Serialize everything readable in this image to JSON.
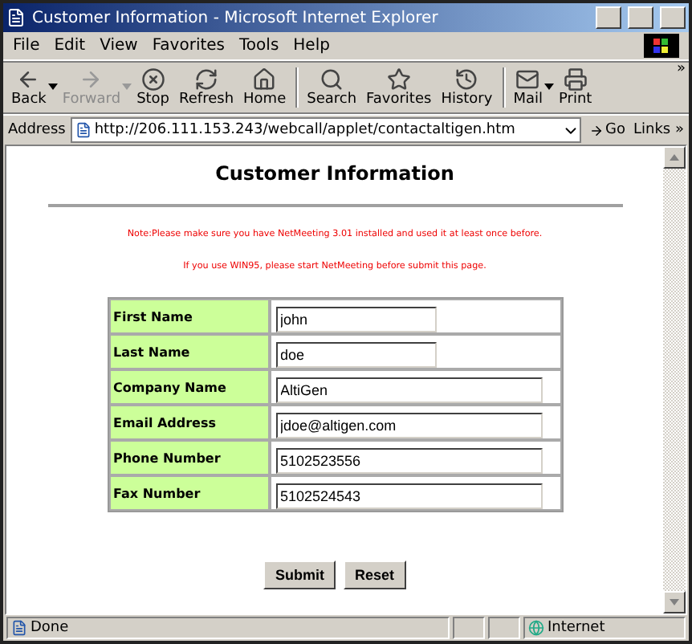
{
  "window": {
    "title": "Customer Information - Microsoft Internet Explorer"
  },
  "menu": [
    "File",
    "Edit",
    "View",
    "Favorites",
    "Tools",
    "Help"
  ],
  "toolbar": {
    "groups": [
      [
        {
          "label": "Back",
          "disabled": false,
          "dropdown": true
        },
        {
          "label": "Forward",
          "disabled": true,
          "dropdown": true
        },
        {
          "label": "Stop",
          "disabled": false,
          "dropdown": false
        },
        {
          "label": "Refresh",
          "disabled": false,
          "dropdown": false
        },
        {
          "label": "Home",
          "disabled": false,
          "dropdown": false
        }
      ],
      [
        {
          "label": "Search",
          "disabled": false,
          "dropdown": false
        },
        {
          "label": "Favorites",
          "disabled": false,
          "dropdown": false
        },
        {
          "label": "History",
          "disabled": false,
          "dropdown": false
        }
      ],
      [
        {
          "label": "Mail",
          "disabled": false,
          "dropdown": true
        },
        {
          "label": "Print",
          "disabled": false,
          "dropdown": false
        }
      ]
    ],
    "more": "»"
  },
  "address_bar": {
    "label": "Address",
    "url": "http://206.111.153.243/webcall/applet/contactaltigen.htm",
    "go": "Go",
    "links": "Links »"
  },
  "page": {
    "heading": "Customer Information",
    "notes": [
      "Note:Please make sure you have NetMeeting 3.01 installed and used it at least once before.",
      "If you use WIN95, please start NetMeeting before submit this page."
    ],
    "form": [
      {
        "label": "First Name",
        "value": "john",
        "kind": "short"
      },
      {
        "label": "Last Name",
        "value": "doe",
        "kind": "short"
      },
      {
        "label": "Company Name",
        "value": "AltiGen",
        "kind": "long"
      },
      {
        "label": "Email Address",
        "value": "jdoe@altigen.com",
        "kind": "long"
      },
      {
        "label": "Phone Number",
        "value": "5102523556",
        "kind": "long"
      },
      {
        "label": "Fax Number",
        "value": "5102524543",
        "kind": "long"
      }
    ],
    "buttons": [
      "Submit",
      "Reset"
    ]
  },
  "status_bar": {
    "text": "Done",
    "zone": "Internet"
  }
}
